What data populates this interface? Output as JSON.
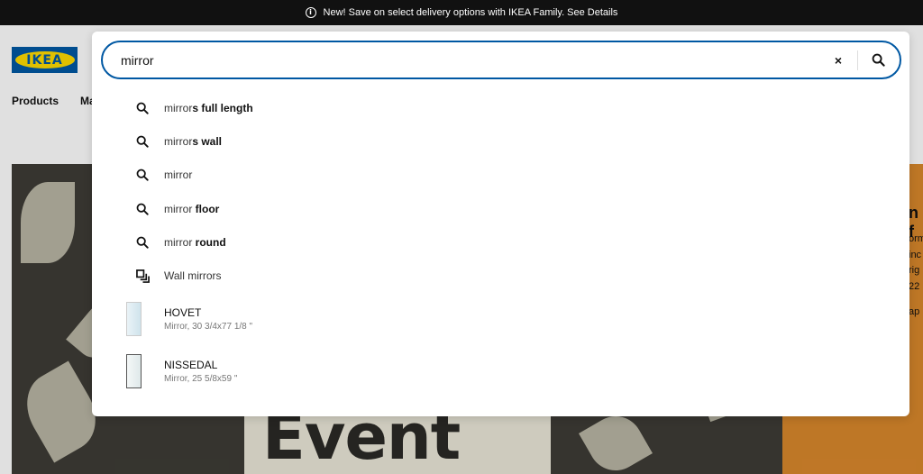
{
  "banner": {
    "text": "New! Save on select delivery options with IKEA Family. See Details",
    "icon": "info-icon"
  },
  "logo": {
    "text": "IKEA"
  },
  "nav": {
    "items": [
      "Products",
      "Ma"
    ]
  },
  "hero": {
    "title": "Event"
  },
  "side_panel": {
    "snippets": [
      "n f",
      "orm",
      "inc",
      "rig",
      "22",
      "ap"
    ]
  },
  "search": {
    "value": "mirror",
    "clear_label": "×",
    "suggestions": [
      {
        "prefix": "mirror",
        "rest": "s full length",
        "icon": "search-icon"
      },
      {
        "prefix": "mirror",
        "rest": "s wall",
        "icon": "search-icon"
      },
      {
        "prefix": "mirror",
        "rest": "",
        "icon": "search-icon"
      },
      {
        "prefix": "mirror ",
        "rest": "floor",
        "icon": "search-icon"
      },
      {
        "prefix": "mirror ",
        "rest": "round",
        "icon": "search-icon"
      },
      {
        "prefix": "Wall mirrors",
        "rest": "",
        "icon": "category-icon"
      }
    ],
    "products": [
      {
        "name": "HOVET",
        "desc": "Mirror, 30 3/4x77 1/8 \""
      },
      {
        "name": "NISSEDAL",
        "desc": "Mirror, 25 5/8x59 \""
      }
    ]
  }
}
